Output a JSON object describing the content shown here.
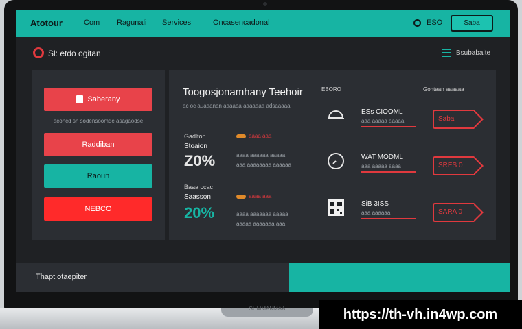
{
  "nav": {
    "brand": "Atotour",
    "links": [
      "Com",
      "Ragunali",
      "Services",
      "Oncasencadonal"
    ],
    "lang": "ESO",
    "cta": "Saba"
  },
  "header": {
    "title": "Sl: etdo ogitan",
    "menu_label": "Bsubabaite"
  },
  "sidebar": {
    "buttons": [
      "Saberany",
      "Raddiban",
      "Raoun",
      "NEBCO"
    ],
    "caption": "aconcd sh sodensoomde asagaodse"
  },
  "main": {
    "title": "Toogosjonamhany Teehoir",
    "subtitle": "ac oc auaaanan aaaaaa aaaaaaa adsaaaaa",
    "col_heads": [
      "EBORO",
      "Gontaan aaaaaa"
    ],
    "rows": [
      {
        "label": "Gadlton",
        "name": "Stoaion",
        "value": "Z0%",
        "value_color": "#e6e6e6",
        "details": [
          "aaaa aaaaaa aaaaa",
          "aaa aaaaaaaa aaaaaa"
        ],
        "tag": "aaaa aaa"
      },
      {
        "label": "Baaa ccac",
        "name": "Saasson",
        "value": "20%",
        "value_color": "#17b4a3",
        "details": [
          "aaaa aaaaaaa aaaaa",
          "aaaaa aaaaaaa aaa"
        ],
        "tag": "aaaa aaa"
      }
    ],
    "items": [
      {
        "icon": "helmet-icon",
        "title": "ESs CIOOML",
        "sub": "aaa aaaaa aaaaa",
        "price": "Saba"
      },
      {
        "icon": "clock-icon",
        "title": "WAT MODML",
        "sub": "aaa aaaaa aaaa",
        "price": "SRES 0"
      },
      {
        "icon": "qr-icon",
        "title": "SiB 3ISS",
        "sub": "aaa aaaaaa",
        "price": "SARA 0"
      }
    ]
  },
  "footer": {
    "text": "Thapt otaepiter"
  },
  "watermark": "https://th-vh.in4wp.com",
  "base_label": "SUMMANMAA",
  "colors": {
    "teal": "#17b4a3",
    "red": "#e8434a",
    "bright_red": "#ff2a2a",
    "panel": "#2b2e33",
    "screen": "#1f2124"
  }
}
